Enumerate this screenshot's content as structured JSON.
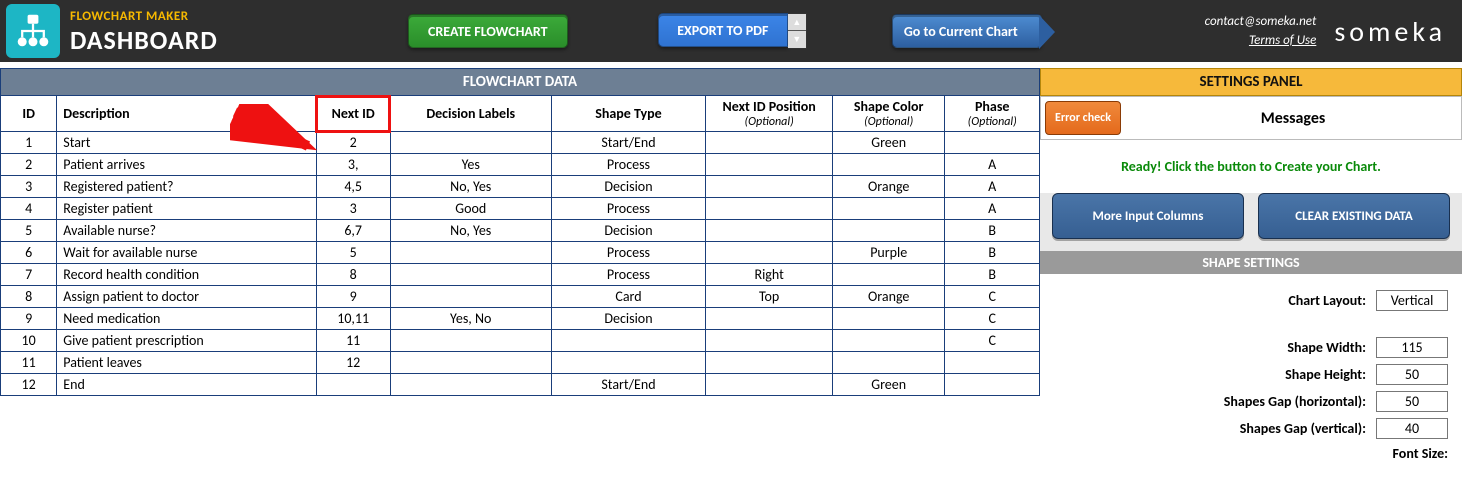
{
  "header": {
    "small": "FLOWCHART MAKER",
    "big": "DASHBOARD",
    "create": "CREATE FLOWCHART",
    "export": "EXPORT TO PDF",
    "current": "Go to Current Chart",
    "contact": "contact@someka.net",
    "terms": "Terms of Use",
    "brand": "someka"
  },
  "table": {
    "title": "FLOWCHART DATA",
    "cols": {
      "id": "ID",
      "desc": "Description",
      "next": "Next ID",
      "dec": "Decision Labels",
      "shape": "Shape Type",
      "pos": "Next ID Position",
      "color": "Shape Color",
      "phase": "Phase",
      "optional": "(Optional)"
    },
    "rows": [
      {
        "id": "1",
        "desc": "Start",
        "next": "2",
        "dec": "",
        "shape": "Start/End",
        "pos": "",
        "color": "Green",
        "phase": ""
      },
      {
        "id": "2",
        "desc": "Patient arrives",
        "next": "3,",
        "dec": "Yes",
        "shape": "Process",
        "pos": "",
        "color": "",
        "phase": "A"
      },
      {
        "id": "3",
        "desc": "Registered patient?",
        "next": "4,5",
        "dec": "No, Yes",
        "shape": "Decision",
        "pos": "",
        "color": "Orange",
        "phase": "A"
      },
      {
        "id": "4",
        "desc": "Register patient",
        "next": "3",
        "dec": "Good",
        "shape": "Process",
        "pos": "",
        "color": "",
        "phase": "A"
      },
      {
        "id": "5",
        "desc": "Available nurse?",
        "next": "6,7",
        "dec": "No, Yes",
        "shape": "Decision",
        "pos": "",
        "color": "",
        "phase": "B"
      },
      {
        "id": "6",
        "desc": "Wait for available nurse",
        "next": "5",
        "dec": "",
        "shape": "Process",
        "pos": "",
        "color": "Purple",
        "phase": "B"
      },
      {
        "id": "7",
        "desc": "Record health condition",
        "next": "8",
        "dec": "",
        "shape": "Process",
        "pos": "Right",
        "color": "",
        "phase": "B"
      },
      {
        "id": "8",
        "desc": "Assign patient to doctor",
        "next": "9",
        "dec": "",
        "shape": "Card",
        "pos": "Top",
        "color": "Orange",
        "phase": "C"
      },
      {
        "id": "9",
        "desc": "Need medication",
        "next": "10,11",
        "dec": "Yes, No",
        "shape": "Decision",
        "pos": "",
        "color": "",
        "phase": "C"
      },
      {
        "id": "10",
        "desc": "Give patient prescription",
        "next": "11",
        "dec": "",
        "shape": "",
        "pos": "",
        "color": "",
        "phase": "C"
      },
      {
        "id": "11",
        "desc": "Patient leaves",
        "next": "12",
        "dec": "",
        "shape": "",
        "pos": "",
        "color": "",
        "phase": ""
      },
      {
        "id": "12",
        "desc": "End",
        "next": "",
        "dec": "",
        "shape": "Start/End",
        "pos": "",
        "color": "Green",
        "phase": ""
      }
    ]
  },
  "settings": {
    "panel": "SETTINGS PANEL",
    "error": "Error check",
    "messages": "Messages",
    "ready": "Ready! Click the button to Create your Chart.",
    "more": "More Input Columns",
    "clear": "CLEAR EXISTING DATA",
    "shape_head": "SHAPE SETTINGS",
    "layout_label": "Chart Layout:",
    "layout_val": "Vertical",
    "width_label": "Shape Width:",
    "width_val": "115",
    "height_label": "Shape Height:",
    "height_val": "50",
    "gaph_label": "Shapes Gap (horizontal):",
    "gaph_val": "50",
    "gapv_label": "Shapes Gap (vertical):",
    "gapv_val": "40",
    "font_label": "Font Size:"
  }
}
